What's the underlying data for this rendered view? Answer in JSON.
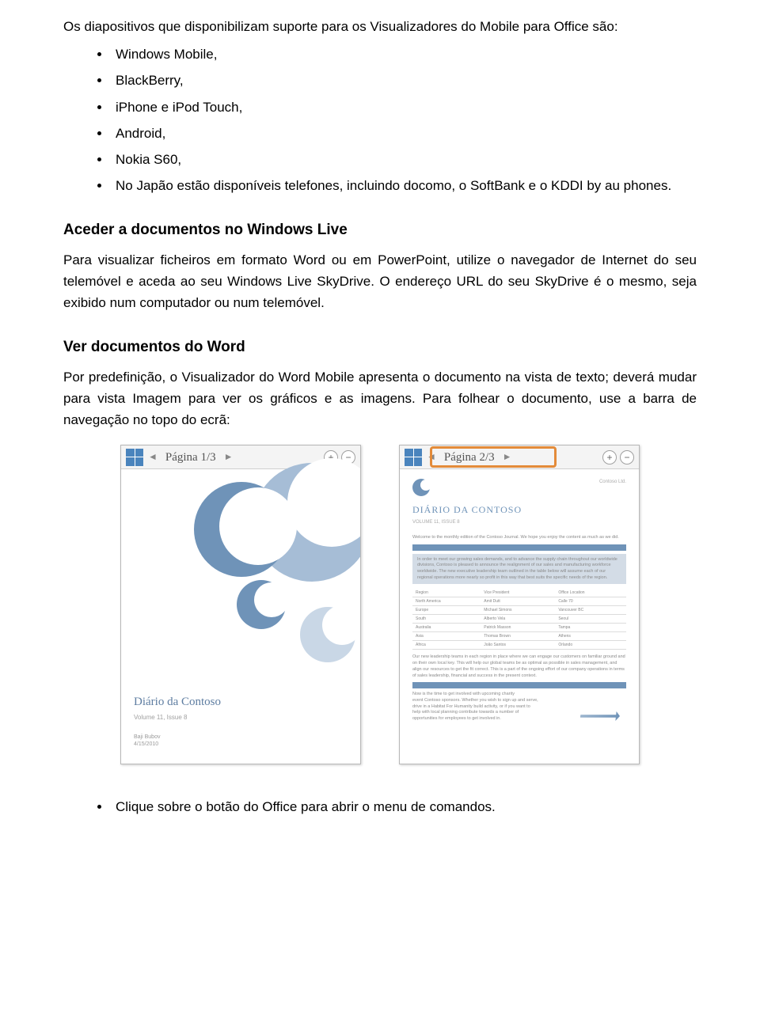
{
  "intro": "Os diapositivos que disponibilizam suporte para os Visualizadores do Mobile para Office são:",
  "devices": [
    "Windows Mobile,",
    "BlackBerry,",
    "iPhone e iPod Touch,",
    "Android,",
    "Nokia S60,",
    "No Japão estão disponíveis telefones, incluindo docomo, o SoftBank e o KDDI by au phones."
  ],
  "section1": {
    "title": "Aceder a documentos no Windows Live",
    "body": "Para visualizar ficheiros em formato Word ou em PowerPoint, utilize o navegador de Internet do seu telemóvel e aceda ao seu Windows Live SkyDrive. O endereço URL do seu SkyDrive é o mesmo, seja exibido num computador ou num telemóvel."
  },
  "section2": {
    "title": "Ver documentos do Word",
    "body": "Por predefinição, o Visualizador do Word Mobile apresenta o documento na vista de texto; deverá mudar para vista Imagem para ver os gráficos e as imagens. Para folhear o documento, use a barra de navegação no topo do ecrã:"
  },
  "screens": {
    "left": {
      "page_label": "Página 1/3",
      "doc_title": "Diário da Contoso",
      "doc_sub": "Volume 11, Issue 8"
    },
    "right": {
      "page_label": "Página 2/3",
      "doc_title": "DIÁRIO DA CONTOSO",
      "doc_vol": "VOLUME 11, ISSUE 8"
    }
  },
  "footer_bullet": "Clique sobre o botão do Office para abrir o menu de comandos."
}
